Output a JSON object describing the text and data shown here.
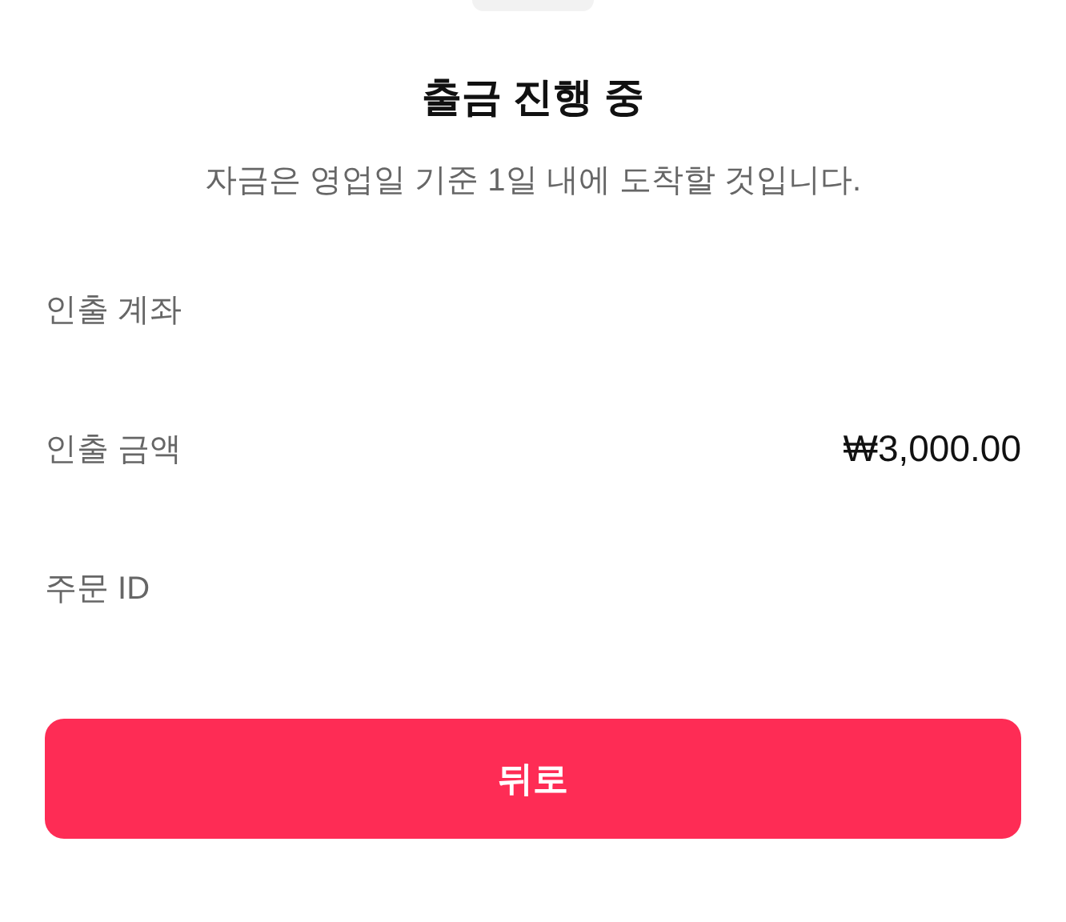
{
  "title": "출금 진행 중",
  "subtitle": "자금은 영업일 기준 1일 내에 도착할 것입니다.",
  "details": [
    {
      "label": "인출 계좌"
    },
    {
      "label": "인출 금액",
      "value": "₩3,000.00"
    },
    {
      "label": "주문 ID"
    }
  ],
  "button": {
    "label": "뒤로"
  }
}
